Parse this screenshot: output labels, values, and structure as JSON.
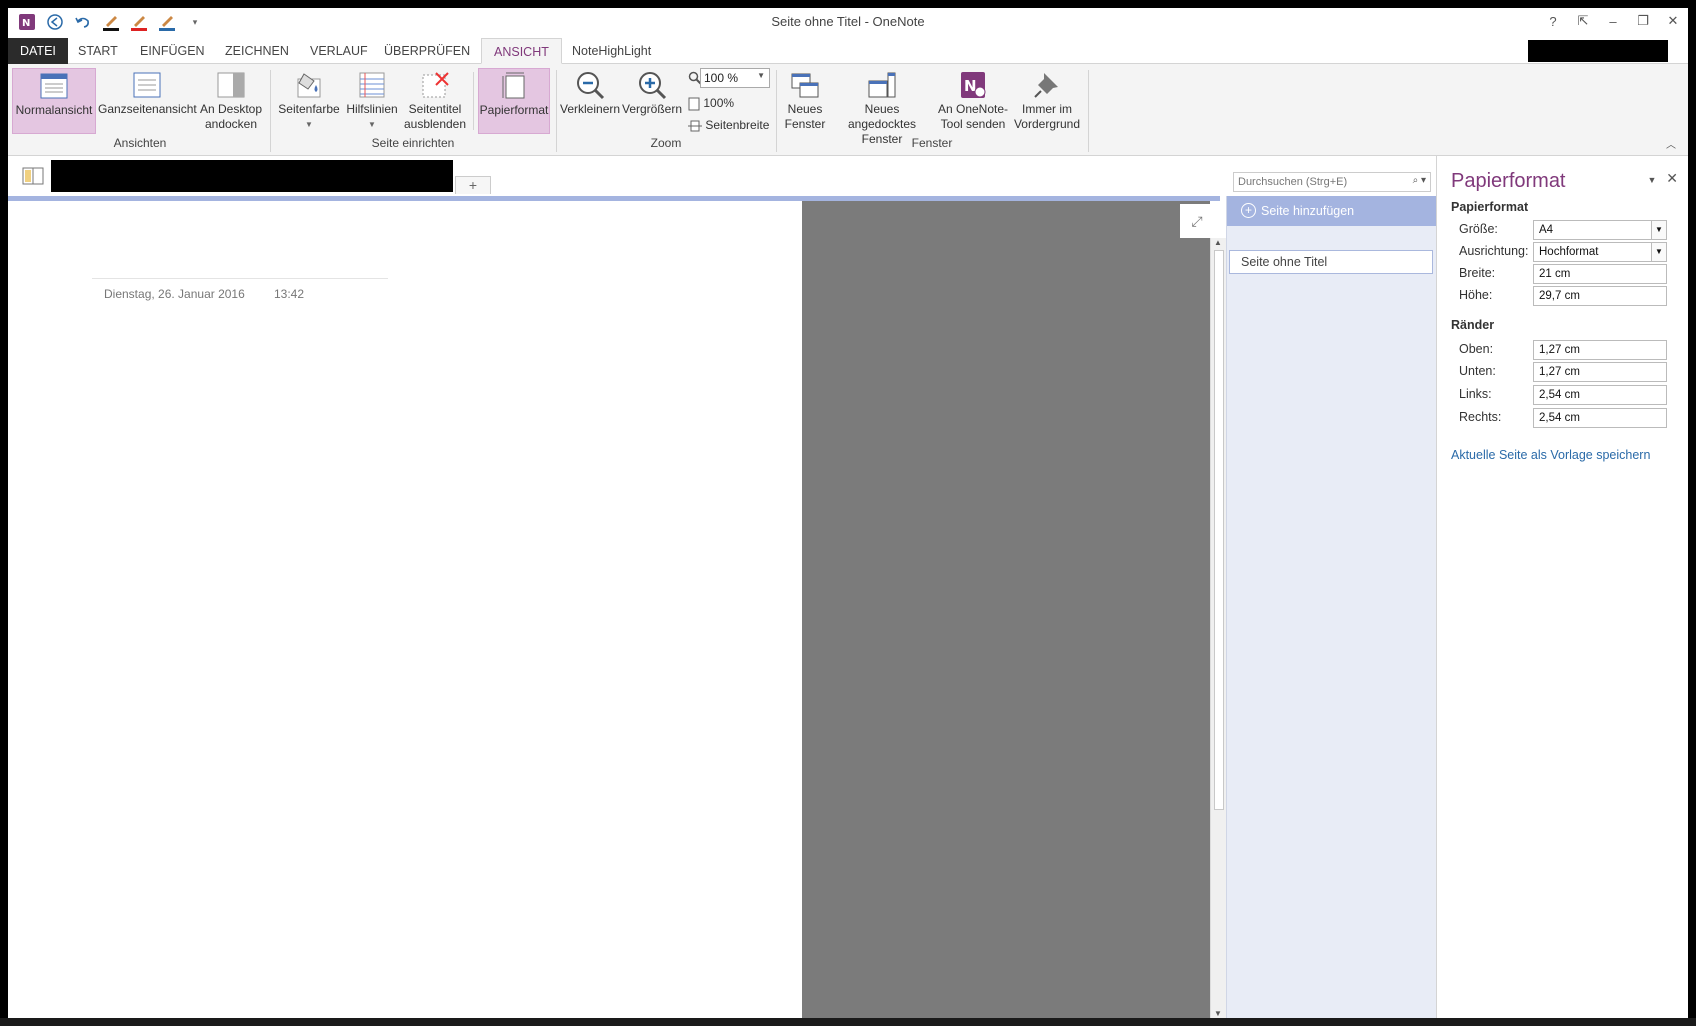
{
  "window": {
    "title": "Seite ohne Titel - OneNote"
  },
  "tabs": [
    "DATEI",
    "START",
    "EINFÜGEN",
    "ZEICHNEN",
    "VERLAUF",
    "ÜBERPRÜFEN",
    "ANSICHT",
    "NoteHighLight"
  ],
  "active_tab": "ANSICHT",
  "window_controls": {
    "help": "?",
    "restore_ribbon": "⇱",
    "minimize": "–",
    "maximize": "❐",
    "close": "✕"
  },
  "ribbon": {
    "ansichten": {
      "group": "Ansichten",
      "normal": "Normalansicht",
      "full": "Ganzseitenansicht",
      "dock1": "An Desktop",
      "dock2": "andocken"
    },
    "seite": {
      "group": "Seite einrichten",
      "color": "Seitenfarbe",
      "lines": "Hilfslinien",
      "hide1": "Seitentitel",
      "hide2": "ausblenden",
      "paper": "Papierformat"
    },
    "zoom": {
      "group": "Zoom",
      "out": "Verkleinern",
      "in": "Vergrößern",
      "value": "100 %",
      "hundred": "100%",
      "width": "Seitenbreite"
    },
    "fenster": {
      "group": "Fenster",
      "new1": "Neues",
      "new2": "Fenster",
      "docked1": "Neues angedocktes",
      "docked2": "Fenster",
      "send1": "An OneNote-",
      "send2": "Tool senden",
      "top1": "Immer im",
      "top2": "Vordergrund"
    }
  },
  "notebook": {
    "add_section": "+"
  },
  "search": {
    "placeholder": "Durchsuchen (Strg+E)"
  },
  "page": {
    "date": "Dienstag, 26. Januar 2016",
    "time": "13:42"
  },
  "pagelist": {
    "add_page": "Seite hinzufügen",
    "items": [
      "Seite ohne Titel"
    ]
  },
  "pane": {
    "title": "Papierformat",
    "section1": "Papierformat",
    "size_label": "Größe:",
    "size_value": "A4",
    "orient_label": "Ausrichtung:",
    "orient_value": "Hochformat",
    "width_label": "Breite:",
    "width_value": "21 cm",
    "height_label": "Höhe:",
    "height_value": "29,7 cm",
    "section2": "Ränder",
    "top_label": "Oben:",
    "top_value": "1,27 cm",
    "bottom_label": "Unten:",
    "bottom_value": "1,27 cm",
    "left_label": "Links:",
    "left_value": "2,54 cm",
    "right_label": "Rechts:",
    "right_value": "2,54 cm",
    "template_link": "Aktuelle Seite als Vorlage speichern"
  },
  "colors": {
    "accent": "#80397b",
    "selected": "#e4c6e1",
    "page_blue": "#a4b4e0",
    "canvas_gray": "#7b7b7b"
  }
}
